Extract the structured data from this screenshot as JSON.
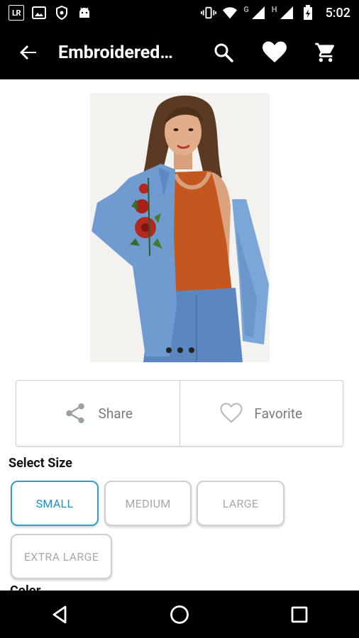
{
  "status_bar": {
    "time": "5:02",
    "left_icons": [
      "lr-app-icon",
      "image-icon",
      "shield-icon",
      "android-icon"
    ],
    "lr_text": "LR",
    "network_g": "G",
    "network_h": "H",
    "right_icons": [
      "vibrate-icon",
      "wifi-icon",
      "signal-icon",
      "signal-icon",
      "battery-icon"
    ]
  },
  "app_bar": {
    "title": "Embroidered…",
    "actions": [
      "search-icon",
      "heart-icon",
      "cart-icon"
    ]
  },
  "product_image": {
    "image_count": 3
  },
  "actions": {
    "share_label": "Share",
    "favorite_label": "Favorite"
  },
  "size_section": {
    "label": "Select Size",
    "options": [
      "SMALL",
      "MEDIUM",
      "LARGE",
      "EXTRA LARGE"
    ],
    "selected": "SMALL"
  },
  "next_section_label": "Color",
  "colors": {
    "accent": "#2c9fd4",
    "bars": "#000000"
  }
}
